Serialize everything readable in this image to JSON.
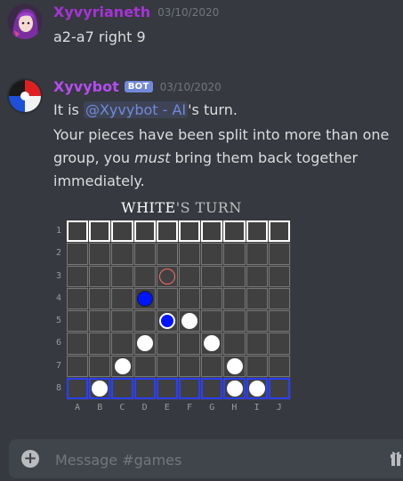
{
  "messages": [
    {
      "username": "Xyvyrianeth",
      "username_color": "#a633d6",
      "timestamp": "03/10/2020",
      "text": "a2-a7 right 9"
    },
    {
      "username": "Xyvybot",
      "username_color": "#b44df0",
      "bot_tag": "BOT",
      "timestamp": "03/10/2020",
      "line1_pre": "It is ",
      "mention": "@Xyvybot - AI",
      "line1_post": "'s turn.",
      "line2": "Your pieces have been split into more than one",
      "line3_pre": "group, you ",
      "line3_em": "must",
      "line3_post": " bring them back together",
      "line4": "immediately."
    }
  ],
  "board": {
    "title_white": "WHITE",
    "title_rest": "'S TURN",
    "ranks": [
      "1",
      "2",
      "3",
      "4",
      "5",
      "6",
      "7",
      "8"
    ],
    "files": [
      "A",
      "B",
      "C",
      "D",
      "E",
      "F",
      "G",
      "H",
      "I",
      "J"
    ],
    "pieces": [
      {
        "file": "E",
        "rank": 3,
        "kind": "target"
      },
      {
        "file": "D",
        "rank": 4,
        "kind": "blue"
      },
      {
        "file": "E",
        "rank": 5,
        "kind": "selected-blue"
      },
      {
        "file": "F",
        "rank": 5,
        "kind": "white"
      },
      {
        "file": "D",
        "rank": 6,
        "kind": "white"
      },
      {
        "file": "G",
        "rank": 6,
        "kind": "white"
      },
      {
        "file": "C",
        "rank": 7,
        "kind": "white"
      },
      {
        "file": "H",
        "rank": 7,
        "kind": "white"
      },
      {
        "file": "B",
        "rank": 8,
        "kind": "white"
      },
      {
        "file": "H",
        "rank": 8,
        "kind": "white"
      },
      {
        "file": "I",
        "rank": 8,
        "kind": "white"
      }
    ]
  },
  "composer": {
    "placeholder": "Message #games"
  }
}
